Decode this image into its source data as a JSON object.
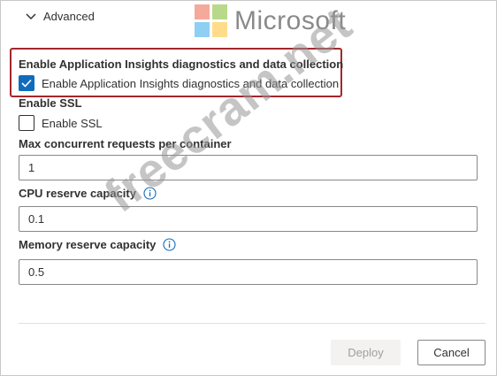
{
  "advanced": {
    "label": "Advanced",
    "icon": "chevron-down-icon"
  },
  "branding": {
    "logo_text": "Microsoft",
    "logo_colors": [
      "#f35325",
      "#81bc06",
      "#05a6f0",
      "#ffba08"
    ],
    "watermark": "freecram.net"
  },
  "app_insights": {
    "heading": "Enable Application Insights diagnostics and data collection",
    "checkbox_label": "Enable Application Insights diagnostics and data collection",
    "checked": true,
    "highlight_color": "#a4262c"
  },
  "ssl": {
    "heading": "Enable SSL",
    "checkbox_label": "Enable SSL",
    "checked": false
  },
  "max_requests": {
    "label": "Max concurrent requests per container",
    "value": "1"
  },
  "cpu_reserve": {
    "label": "CPU reserve capacity",
    "value": "0.1",
    "icon": "info-icon"
  },
  "memory_reserve": {
    "label": "Memory reserve capacity",
    "value": "0.5",
    "icon": "info-icon"
  },
  "buttons": {
    "deploy_label": "Deploy",
    "deploy_enabled": false,
    "cancel_label": "Cancel"
  },
  "colors": {
    "accent": "#0f6cbd",
    "text": "#323130",
    "disabled_text": "#a19f9d"
  }
}
